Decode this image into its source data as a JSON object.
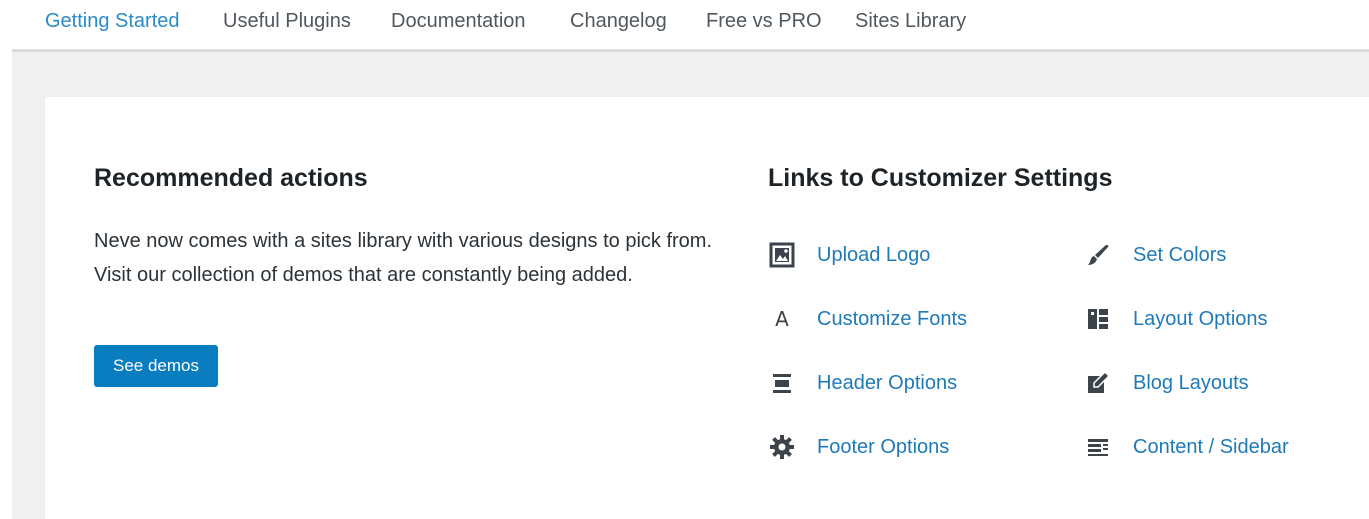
{
  "tabs": [
    {
      "label": "Getting Started",
      "active": true
    },
    {
      "label": "Useful Plugins",
      "active": false
    },
    {
      "label": "Documentation",
      "active": false
    },
    {
      "label": "Changelog",
      "active": false
    },
    {
      "label": "Free vs PRO",
      "active": false
    },
    {
      "label": "Sites Library",
      "active": false
    }
  ],
  "recommended": {
    "title": "Recommended actions",
    "description": "Neve now comes with a sites library with various designs to pick from. Visit our collection of demos that are constantly being added.",
    "button_label": "See demos"
  },
  "customizer": {
    "title": "Links to Customizer Settings",
    "links": [
      {
        "label": "Upload Logo",
        "icon": "image-icon"
      },
      {
        "label": "Set Colors",
        "icon": "brush-icon"
      },
      {
        "label": "Customize Fonts",
        "icon": "font-icon",
        "icon_glyph": "A"
      },
      {
        "label": "Layout Options",
        "icon": "layout-icon"
      },
      {
        "label": "Header Options",
        "icon": "header-icon"
      },
      {
        "label": "Blog Layouts",
        "icon": "edit-icon"
      },
      {
        "label": "Footer Options",
        "icon": "gear-icon"
      },
      {
        "label": "Content / Sidebar",
        "icon": "sidebar-icon"
      }
    ]
  },
  "colors": {
    "accent": "#2a8bc9",
    "button": "#0a7cc0",
    "link": "#1f7ab8"
  }
}
